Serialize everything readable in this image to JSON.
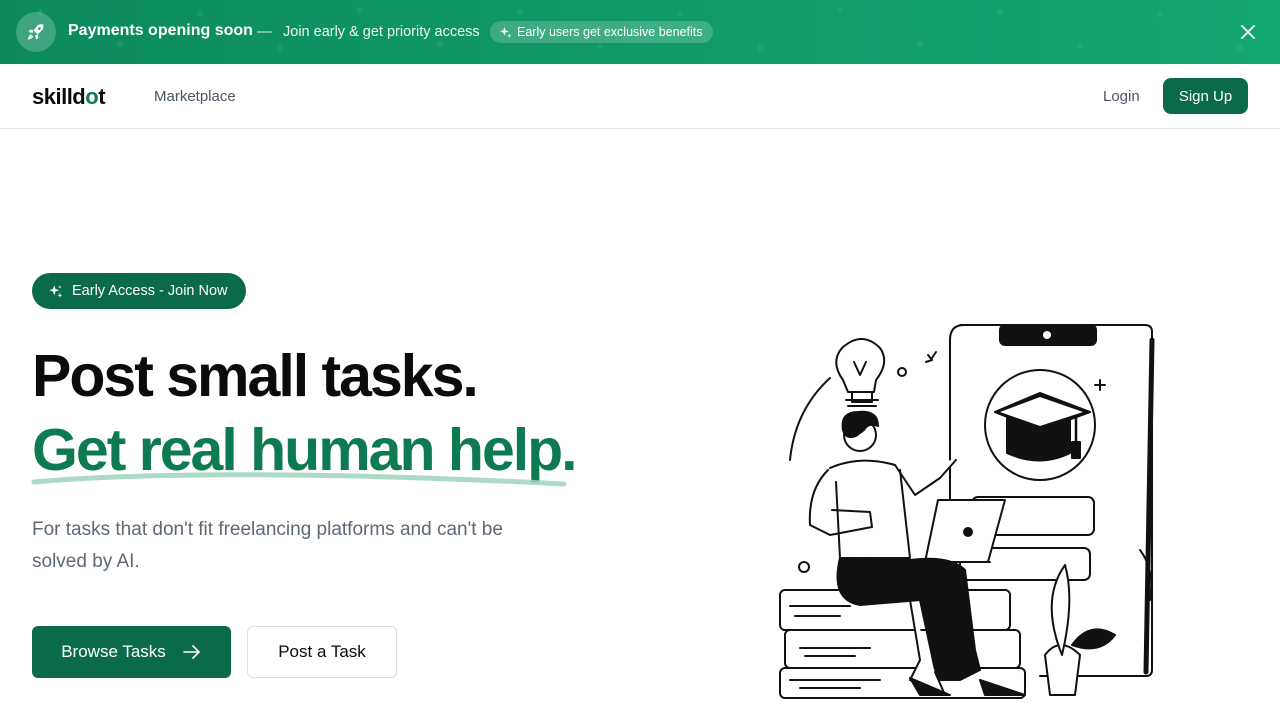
{
  "banner": {
    "title": "Payments opening soon",
    "dash": "—",
    "subtitle": "Join early & get priority access",
    "pill": "Early users get exclusive benefits",
    "icon": "rocket-icon",
    "close_icon": "close-icon"
  },
  "header": {
    "logo_main": "skilld",
    "logo_accent": "o",
    "logo_end": "t",
    "nav": [
      "Marketplace"
    ],
    "login": "Login",
    "signup": "Sign Up"
  },
  "hero": {
    "badge": "Early Access - Join Now",
    "headline": "Post small tasks.",
    "headline_accent": "Get real human help.",
    "description": "For tasks that don't fit freelancing platforms and can't be solved by AI.",
    "primary_button": "Browse Tasks",
    "secondary_button": "Post a Task"
  },
  "colors": {
    "brand": "#0b6b48",
    "accent_text": "#0d7a52",
    "banner_start": "#0c8a5c",
    "banner_end": "#14a873"
  }
}
